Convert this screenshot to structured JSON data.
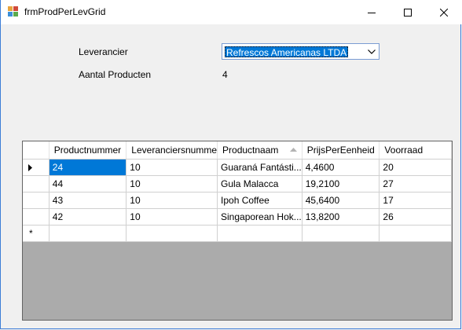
{
  "window": {
    "title": "frmProdPerLevGrid",
    "icon": "winforms-app-icon",
    "controls": [
      "minimize-icon",
      "maximize-icon",
      "close-icon"
    ]
  },
  "form": {
    "supplier_label": "Leverancier",
    "supplier_value": "Refrescos Americanas LTDA",
    "count_label": "Aantal Producten",
    "count_value": "4"
  },
  "grid": {
    "columns": [
      "Productnummer",
      "Leveranciersnumme",
      "Productnaam",
      "PrijsPerEenheid",
      "Voorraad"
    ],
    "sorted_column": "Productnaam",
    "rows": [
      [
        "24",
        "10",
        "Guaraná Fantásti...",
        "4,4600",
        "20"
      ],
      [
        "44",
        "10",
        "Gula Malacca",
        "19,2100",
        "27"
      ],
      [
        "43",
        "10",
        "Ipoh Coffee",
        "45,6400",
        "17"
      ],
      [
        "42",
        "10",
        "Singaporean Hok...",
        "13,8200",
        "26"
      ]
    ],
    "new_row_marker": "*"
  },
  "colors": {
    "selection": "#0078d7",
    "grid_background": "#ababab",
    "window_border": "#3c7dd7"
  }
}
